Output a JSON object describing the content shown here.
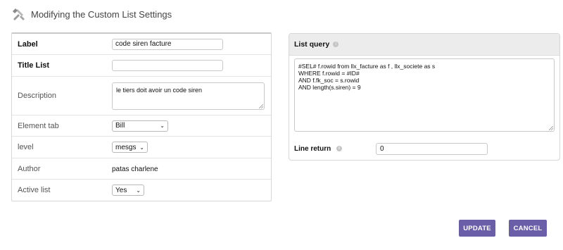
{
  "header": {
    "title": "Modifying the Custom List Settings",
    "icon": "tools-icon"
  },
  "form": {
    "label": {
      "label": "Label",
      "value": "code siren facture"
    },
    "title_list": {
      "label": "Title List",
      "value": ""
    },
    "description": {
      "label": "Description",
      "value": "le tiers doit avoir un code siren"
    },
    "element_tab": {
      "label": "Element tab",
      "value": "Bill"
    },
    "level": {
      "label": "level",
      "value": "mesgs"
    },
    "author": {
      "label": "Author",
      "value": "patas charlene"
    },
    "active_list": {
      "label": "Active list",
      "value": "Yes"
    }
  },
  "query_panel": {
    "title": "List query",
    "query_lines": [
      "#SEL# f.rowid from llx_facture as f , llx_societe as s",
      "WHERE f.rowid = #ID#",
      "AND f.fk_soc = s.rowid",
      "AND length(s.siren) = 9"
    ],
    "line_return": {
      "label": "Line return",
      "value": "0"
    }
  },
  "buttons": {
    "update": "UPDATE",
    "cancel": "CANCEL"
  },
  "colors": {
    "accent": "#6b5ea8",
    "header_bg": "#ececec"
  }
}
